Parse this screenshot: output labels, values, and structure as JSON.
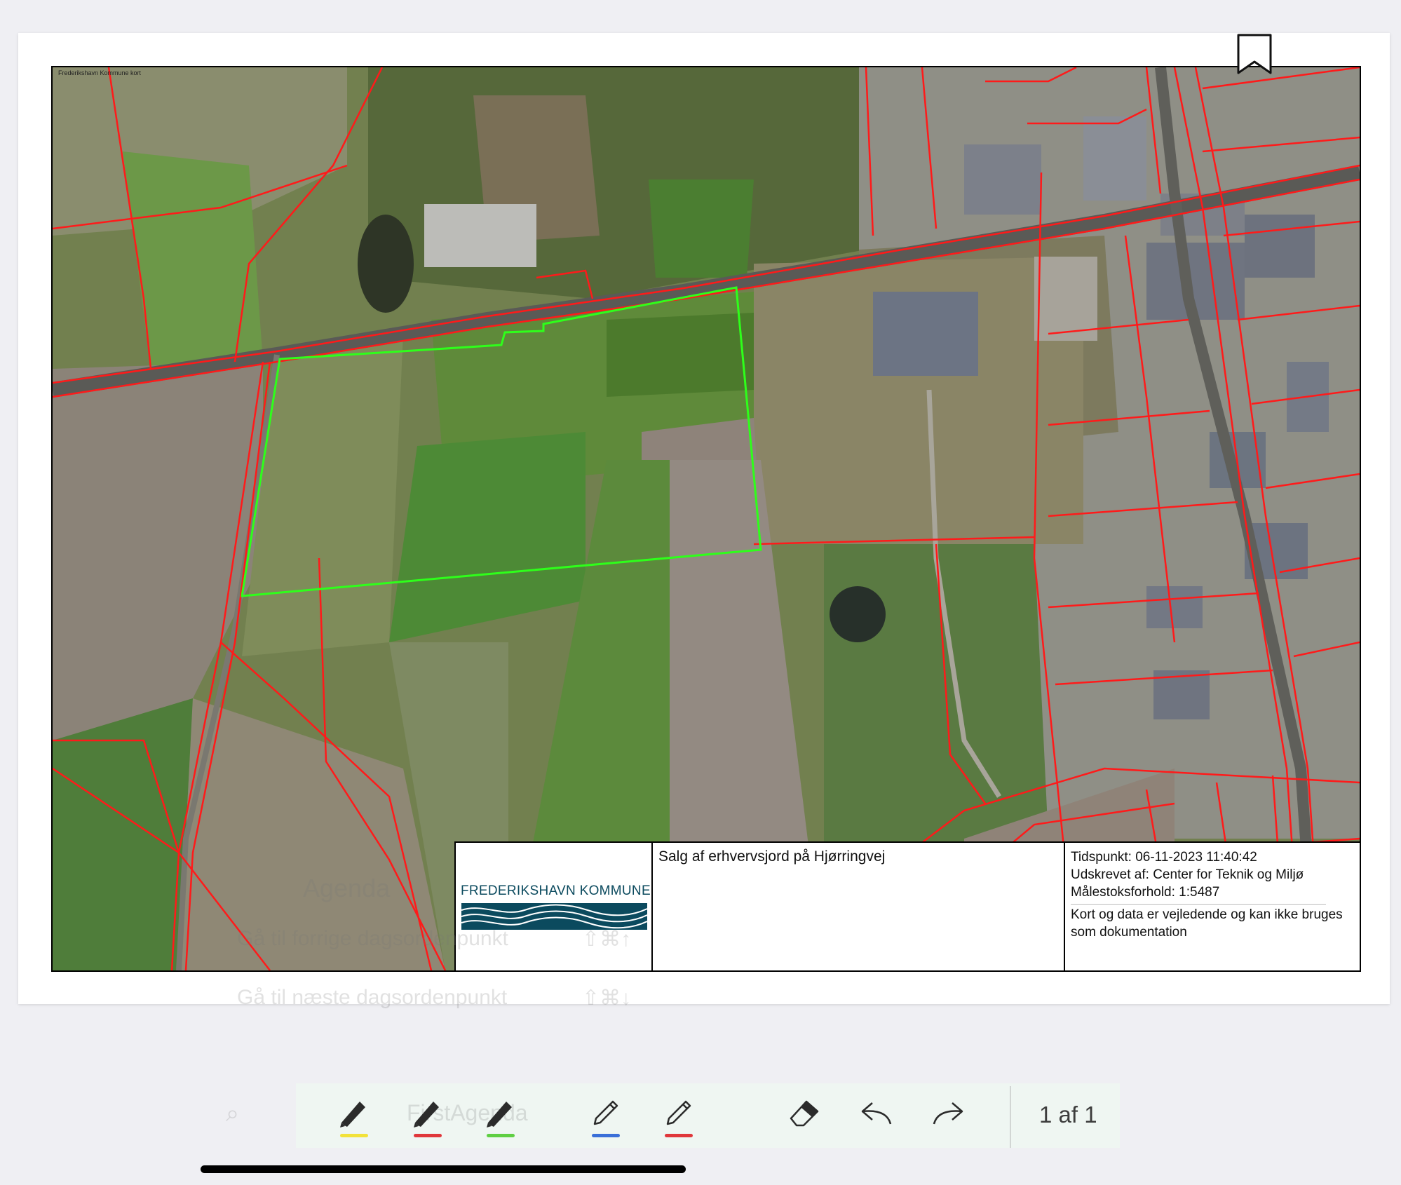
{
  "map": {
    "caption": "Frederikshavn Kommune kort"
  },
  "infobox": {
    "logo_text": "FREDERIKSHAVN KOMMUNE",
    "title": "Salg af erhvervsjord på Hjørringvej",
    "timestamp": "Tidspunkt: 06-11-2023 11:40:42",
    "printed_by": "Udskrevet af: Center for Teknik og Miljø",
    "scale": "Målestoksforhold: 1:5487",
    "disclaimer": "Kort og data er vejledende og kan ikke bruges som dokumentation"
  },
  "ghost_menu": {
    "heading": "Agenda",
    "item_prev": "Gå til forrige dagsordenpunkt",
    "item_prev_shortcut": "⇧⌘↑",
    "item_next": "Gå til næste dagsordenpunkt",
    "item_next_shortcut": "⇧⌘↓",
    "search_text": "FirstAgenda"
  },
  "toolbar": {
    "tools": [
      {
        "name": "marker-yellow",
        "color": "#f2e23a"
      },
      {
        "name": "marker-red",
        "color": "#e0373b"
      },
      {
        "name": "marker-green",
        "color": "#5fcf43"
      },
      {
        "name": "pen-blue",
        "color": "#3a6fd8"
      },
      {
        "name": "pen-red",
        "color": "#e0373b"
      }
    ],
    "page_indicator": "1 af 1"
  },
  "colors": {
    "boundary": "#ff1a1a",
    "highlight": "#2eff1a",
    "logo": "#0b4a5e"
  }
}
